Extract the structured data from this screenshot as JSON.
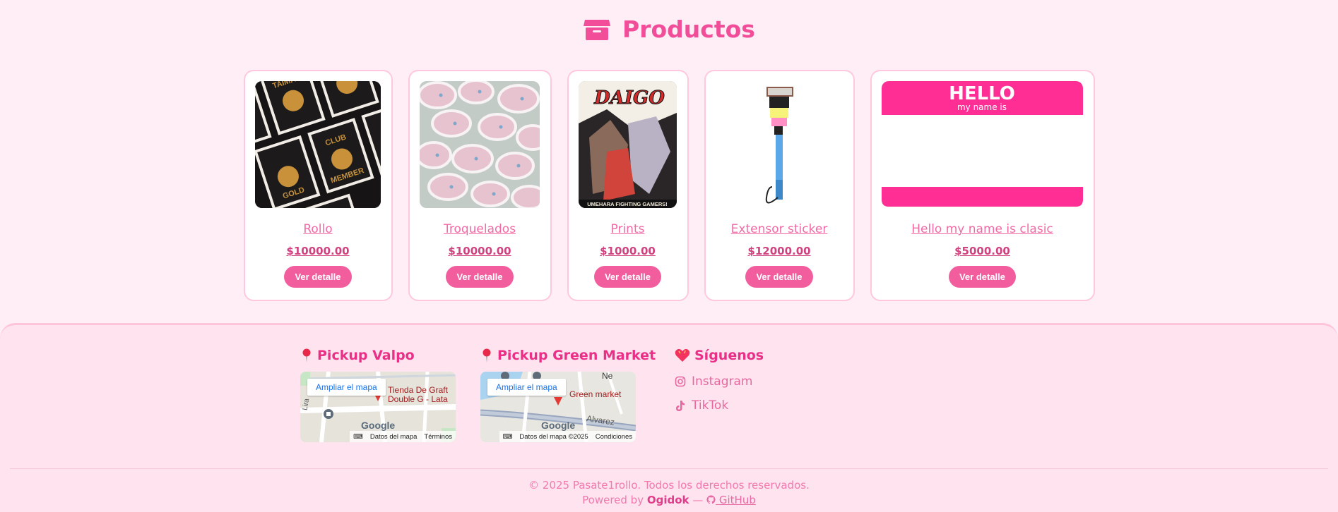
{
  "header": {
    "title": "Productos",
    "icon": "box-icon"
  },
  "products": [
    {
      "name": "Rollo",
      "price": "$10000.00",
      "button": "Ver detalle"
    },
    {
      "name": "Troquelados",
      "price": "$10000.00",
      "button": "Ver detalle"
    },
    {
      "name": "Prints",
      "price": "$1000.00",
      "button": "Ver detalle"
    },
    {
      "name": "Extensor sticker",
      "price": "$12000.00",
      "button": "Ver detalle"
    },
    {
      "name": "Hello my name is clasic",
      "price": "$5000.00",
      "button": "Ver detalle"
    }
  ],
  "product_images": {
    "rollo": {
      "line1": "TAIMAO",
      "line2": "CLUB",
      "line3": "GOLD",
      "line4": "MEMBER"
    },
    "prints": {
      "title": "DAIGO",
      "bottom": "UMEHARA FIGHTING GAMERS!"
    },
    "hello": {
      "big": "HELLO",
      "small": "my name is"
    }
  },
  "footer": {
    "pickup_valpo": {
      "title": "Pickup Valpo",
      "enlarge": "Ampliar el mapa",
      "place": "Tienda De Graft Double G - Lata",
      "place_line1": "Tienda De Graft",
      "place_line2": "Double G -  Lata",
      "street": "Lira",
      "google": "Google",
      "attr_data": "Datos del mapa",
      "attr_terms": "Términos"
    },
    "pickup_green": {
      "title": "Pickup Green Market",
      "enlarge": "Ampliar el mapa",
      "place": "Green market",
      "street": "Alvarez",
      "ne": "Ne",
      "google": "Google",
      "attr_data": "Datos del mapa ©2025",
      "attr_terms": "Condiciones"
    },
    "social": {
      "title": "Síguenos",
      "instagram": "Instagram",
      "tiktok": "TikTok"
    },
    "copyright": "© 2025 Pasate1rollo. Todos los derechos reservados.",
    "powered_prefix": "Powered by",
    "powered_brand": "Ogidok",
    "powered_sep": "—",
    "github": "GitHub"
  },
  "colors": {
    "background": "#ffeef5",
    "accent": "#f24d99",
    "button": "#f25d9e",
    "footer_bg": "#ffe3ef"
  }
}
